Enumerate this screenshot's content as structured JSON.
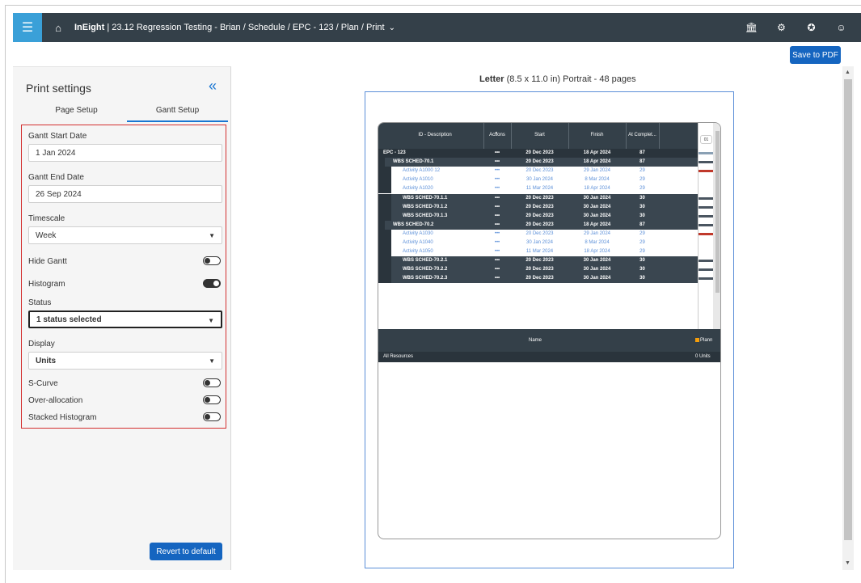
{
  "topbar": {
    "menu_icon": "hamburger-icon",
    "home_icon": "home-icon",
    "brand": "InEight",
    "breadcrumb": "| 23.12 Regression Testing - Brian / Schedule / EPC - 123 / Plan / Print",
    "icons": [
      "bank-icon",
      "settings-icon",
      "openai-icon",
      "user-icon"
    ]
  },
  "toolbar": {
    "save_label": "Save to PDF"
  },
  "print_settings": {
    "title": "Print settings",
    "tabs": [
      "Page Setup",
      "Gantt Setup"
    ],
    "active_tab": "Gantt Setup",
    "gantt_start_label": "Gantt Start Date",
    "gantt_start_value": "1 Jan 2024",
    "gantt_end_label": "Gantt End Date",
    "gantt_end_value": "26 Sep 2024",
    "timescale_label": "Timescale",
    "timescale_value": "Week",
    "hide_gantt_label": "Hide Gantt",
    "hide_gantt_on": false,
    "histogram_label": "Histogram",
    "histogram_on": true,
    "status_label": "Status",
    "status_value": "1 status selected",
    "display_label": "Display",
    "display_value": "Units",
    "scurve_label": "S-Curve",
    "scurve_on": false,
    "overalloc_label": "Over-allocation",
    "overalloc_on": false,
    "stacked_label": "Stacked Histogram",
    "stacked_on": false,
    "revert_label": "Revert to default"
  },
  "preview": {
    "paper": "Letter",
    "details": "(8.5 x 11.0 in) Portrait - 48 pages",
    "columns": [
      "ID - Description",
      "Actions",
      "Start",
      "Finish",
      "At Complet..."
    ],
    "timeline_label": "01",
    "rows": [
      {
        "id": "EPC - 123",
        "start": "20 Dec 2023",
        "finish": "18 Apr 2024",
        "ac": "87",
        "kind": "dark",
        "indent": 0
      },
      {
        "id": "WBS SCHED-70.1",
        "start": "20 Dec 2023",
        "finish": "18 Apr 2024",
        "ac": "87",
        "kind": "wbs",
        "indent": 1
      },
      {
        "id": "Activity A1000 12",
        "start": "20 Dec 2023",
        "finish": "29 Jan 2024",
        "ac": "29",
        "kind": "act",
        "indent": 2
      },
      {
        "id": "Activity A1010",
        "start": "30 Jan 2024",
        "finish": "8 Mar 2024",
        "ac": "29",
        "kind": "act",
        "indent": 2
      },
      {
        "id": "Activity A1020",
        "start": "11 Mar 2024",
        "finish": "18 Apr 2024",
        "ac": "29",
        "kind": "act",
        "indent": 2
      },
      {
        "id": "WBS SCHED-70.1.1",
        "start": "20 Dec 2023",
        "finish": "30 Jan 2024",
        "ac": "30",
        "kind": "wbs",
        "indent": 2
      },
      {
        "id": "WBS SCHED-70.1.2",
        "start": "20 Dec 2023",
        "finish": "30 Jan 2024",
        "ac": "30",
        "kind": "wbs",
        "indent": 2
      },
      {
        "id": "WBS SCHED-70.1.3",
        "start": "20 Dec 2023",
        "finish": "30 Jan 2024",
        "ac": "30",
        "kind": "wbs",
        "indent": 2
      },
      {
        "id": "WBS SCHED-70.2",
        "start": "20 Dec 2023",
        "finish": "18 Apr 2024",
        "ac": "87",
        "kind": "wbs",
        "indent": 1
      },
      {
        "id": "Activity A1030",
        "start": "20 Dec 2023",
        "finish": "29 Jan 2024",
        "ac": "29",
        "kind": "act",
        "indent": 2
      },
      {
        "id": "Activity A1040",
        "start": "30 Jan 2024",
        "finish": "8 Mar 2024",
        "ac": "29",
        "kind": "act",
        "indent": 2
      },
      {
        "id": "Activity A1050",
        "start": "11 Mar 2024",
        "finish": "18 Apr 2024",
        "ac": "29",
        "kind": "act",
        "indent": 2
      },
      {
        "id": "WBS SCHED-70.2.1",
        "start": "20 Dec 2023",
        "finish": "30 Jan 2024",
        "ac": "30",
        "kind": "wbs",
        "indent": 2
      },
      {
        "id": "WBS SCHED-70.2.2",
        "start": "20 Dec 2023",
        "finish": "30 Jan 2024",
        "ac": "30",
        "kind": "wbs",
        "indent": 2
      },
      {
        "id": "WBS SCHED-70.2.3",
        "start": "20 Dec 2023",
        "finish": "30 Jan 2024",
        "ac": "30",
        "kind": "wbs",
        "indent": 2
      }
    ],
    "actions_glyph": "•••",
    "resource_header": "Name",
    "resource_legend": "Plann",
    "resource_row_name": "All Resources",
    "resource_row_units": "0 Units",
    "colors": {
      "dark": "#2a343c",
      "wbs": "#3a4650",
      "activity_text": "#5b8fd8",
      "bar_red": "#c0392b",
      "bar_gray": "#4a5560"
    }
  }
}
